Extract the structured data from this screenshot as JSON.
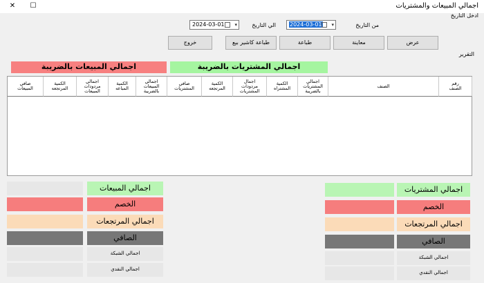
{
  "window": {
    "title": "اجمالي المبيعات والمشتريات",
    "close_glyph": "✕",
    "max_glyph": "☐"
  },
  "dates": {
    "section_label": "ادخل التاريخ",
    "from_label": "من التاريخ",
    "from_value": "2024-03-01",
    "to_label": "الي التاريخ",
    "to_value": "2024-03-01",
    "drop_glyph": "▾"
  },
  "buttons": {
    "view": "عرض",
    "preview": "معاينة",
    "print": "طباعة",
    "print_cashier": "طباعة كاشير بيع",
    "exit": "خروج"
  },
  "report_label": "التقرير",
  "bars": {
    "purchases_tax": "اجمالي المشتريات بالضريبة",
    "sales_tax": "اجمالي المبيعات بالضريبة"
  },
  "grid": {
    "columns": [
      "رقم\nالصنف",
      "الصنف",
      "اجمالي\nالمشتريات\nبالضريبة",
      "الكمية\nالمشتراه",
      "اجمال\nمردودات\nالمشتريات",
      "الكمية\nالمرتجعه",
      "صافي\nالمشتريات",
      "اجمالي\nالمبيعات\nبالضريبة",
      "الكمية\nالمباعه",
      "اجمالي\nمردودات\nالمبيعات",
      "الكمية\nالمرتجعه",
      "صافي\nالمبيعات"
    ]
  },
  "sales_summary": {
    "total_label": "اجمالي المبيعات",
    "discount_label": "الخصم",
    "returns_label": "اجمالي المرتجعات",
    "net_label": "الصافي",
    "network_label": "اجمالي الشبكة",
    "cash_label": "اجمالي النقدي"
  },
  "purchases_summary": {
    "total_label": "اجمالي المشتريات",
    "discount_label": "الخصم",
    "returns_label": "اجمالي المرتجعات",
    "net_label": "الصافي",
    "network_label": "اجمالي الشبكة",
    "cash_label": "اجمالي النقدي"
  },
  "colors": {
    "green": "#b9f5b4",
    "red": "#f67d7d",
    "peach": "#fbdbb8",
    "dark": "#777777",
    "grey": "#e7e7e7",
    "date_highlight": "#1e6fd6"
  }
}
